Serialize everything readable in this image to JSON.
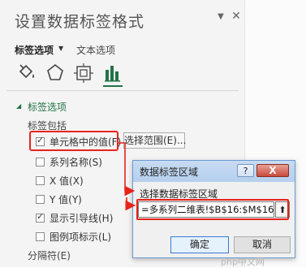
{
  "pane": {
    "title": "设置数据标签格式",
    "tabs": {
      "label_options": "标签选项",
      "text_options": "文本选项"
    },
    "icons": [
      "fill-line-icon",
      "effects-icon",
      "size-properties-icon",
      "chart-options-icon"
    ],
    "section_title": "标签选项",
    "group_label": "标签包括",
    "checkboxes": [
      {
        "label": "单元格中的值(F)",
        "checked": true
      },
      {
        "label": "系列名称(S)",
        "checked": false
      },
      {
        "label": "X 值(X)",
        "checked": false
      },
      {
        "label": "Y 值(Y)",
        "checked": false
      },
      {
        "label": "显示引导线(H)",
        "checked": true
      },
      {
        "label": "图例项标示(L)",
        "checked": false
      }
    ],
    "range_button": "选择范围(E)...",
    "separator_label": "分隔符(E)"
  },
  "dialog": {
    "title": "数据标签区域",
    "help_label": "?",
    "close_label": "X",
    "field_label": "选择数据标签区域",
    "input_value": "=多系列二维表!$B$16:$M$16",
    "ok_label": "确定",
    "cancel_label": "取消"
  },
  "watermark": "php中文网",
  "colors": {
    "accent": "#217346",
    "highlight": "#e8231b"
  }
}
